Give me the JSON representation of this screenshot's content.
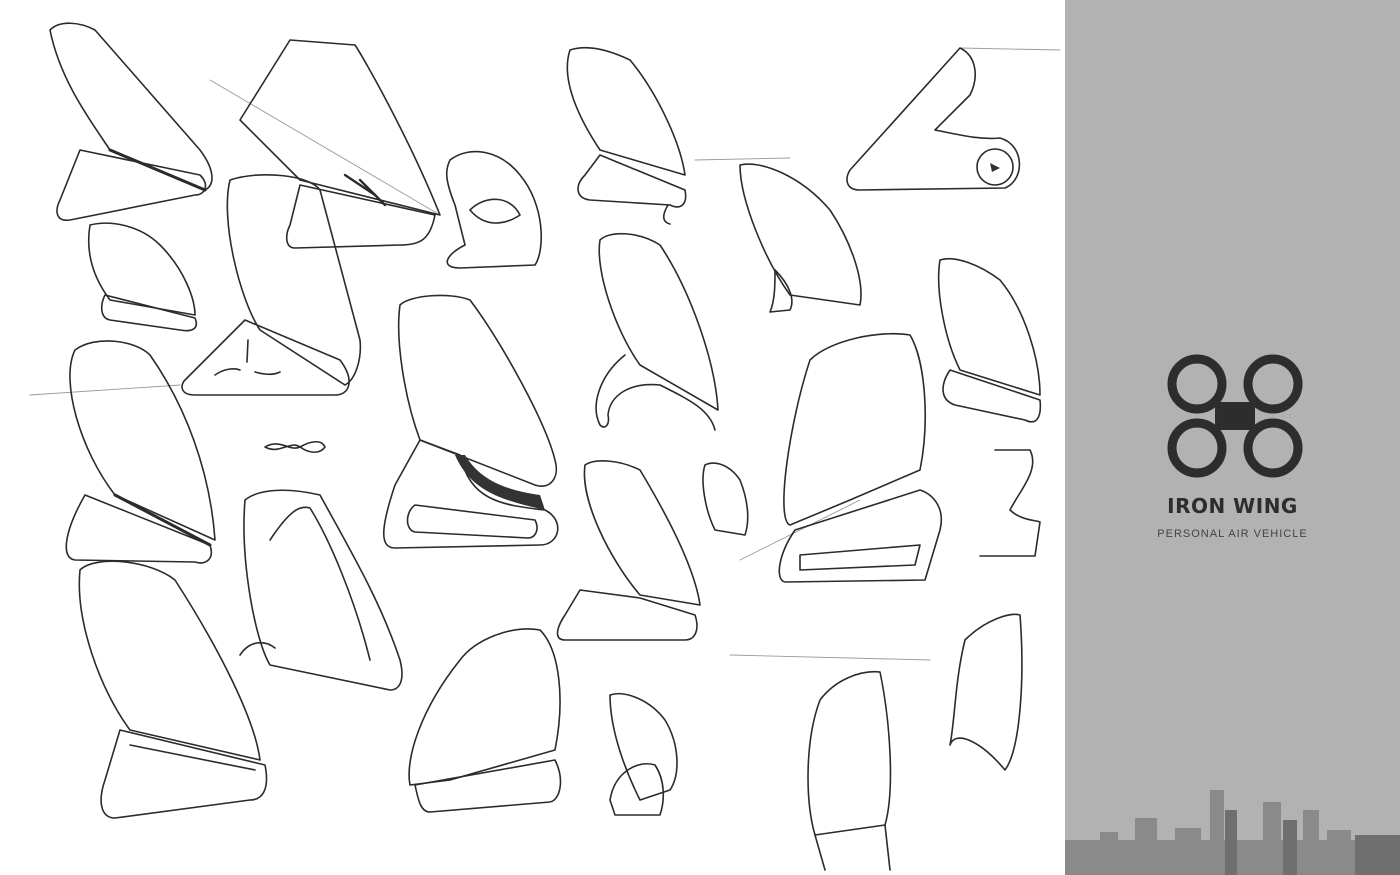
{
  "brand": {
    "title": "IRON WING",
    "subtitle": "PERSONAL AIR VEHICLE",
    "logo_icon": "quad-rotor-logo-icon"
  },
  "colors": {
    "sheet_background": "#ffffff",
    "panel_background": "#b2b2b2",
    "ink": "#2b2b2b",
    "logo": "#2d2d2d",
    "skyline": "#8a8a8a"
  }
}
